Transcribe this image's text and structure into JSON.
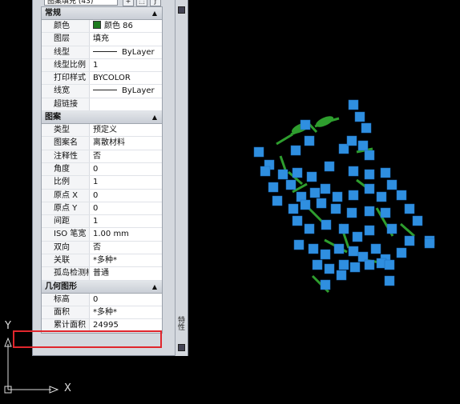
{
  "palette": {
    "object_type": "图案填充 (43)",
    "sections": [
      {
        "title": "常规",
        "rows": [
          {
            "label": "颜色",
            "value": "颜色 86",
            "swatch": "#1e7b1e"
          },
          {
            "label": "图层",
            "value": "填充"
          },
          {
            "label": "线型",
            "value": "ByLayer",
            "line": true
          },
          {
            "label": "线型比例",
            "value": "1"
          },
          {
            "label": "打印样式",
            "value": "BYCOLOR"
          },
          {
            "label": "线宽",
            "value": "ByLayer",
            "line": true
          },
          {
            "label": "超链接",
            "value": ""
          }
        ]
      },
      {
        "title": "图案",
        "rows": [
          {
            "label": "类型",
            "value": "预定义"
          },
          {
            "label": "图案名",
            "value": "离散材料"
          },
          {
            "label": "注释性",
            "value": "否"
          },
          {
            "label": "角度",
            "value": "0"
          },
          {
            "label": "比例",
            "value": "1"
          },
          {
            "label": "原点 X",
            "value": "0"
          },
          {
            "label": "原点 Y",
            "value": "0"
          },
          {
            "label": "间距",
            "value": "1"
          },
          {
            "label": "ISO 笔宽",
            "value": "1.00 mm"
          },
          {
            "label": "双向",
            "value": "否"
          },
          {
            "label": "关联",
            "value": "*多种*"
          },
          {
            "label": "孤岛检测样...",
            "value": "普通"
          }
        ]
      },
      {
        "title": "几何图形",
        "rows": [
          {
            "label": "标高",
            "value": "0"
          },
          {
            "label": "面积",
            "value": "*多种*"
          },
          {
            "label": "累计面积",
            "value": "24995"
          }
        ]
      }
    ],
    "side_label": "特性",
    "colors": {
      "grip": "#2f8fe0",
      "hatch": "#2e9e2e",
      "highlight": "#e0262c"
    }
  },
  "ucs": {
    "x_label": "X",
    "y_label": "Y"
  }
}
